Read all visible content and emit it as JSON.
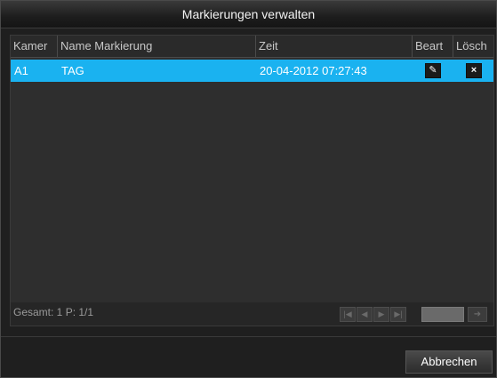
{
  "window": {
    "title": "Markierungen verwalten"
  },
  "table": {
    "columns": [
      "Kamer",
      "Name Markierung",
      "Zeit",
      "Beart",
      "Lösch"
    ],
    "rows": [
      {
        "camera": "A1",
        "name": "TAG",
        "time": "20-04-2012 07:27:43",
        "edit_icon": "pencil-icon",
        "delete_icon": "close-icon"
      }
    ]
  },
  "footer": {
    "total_label": "Gesamt: 1 P: 1/1",
    "pager": {
      "first_icon": "first-page-icon",
      "prev_icon": "previous-page-icon",
      "next_icon": "next-page-icon",
      "last_icon": "last-page-icon",
      "go_icon": "go-arrow-icon"
    }
  },
  "buttons": {
    "cancel": "Abbrechen"
  },
  "colors": {
    "selected_row": "#1ab2f0",
    "background": "#1f1f1f",
    "panel": "#2e2e2e"
  }
}
